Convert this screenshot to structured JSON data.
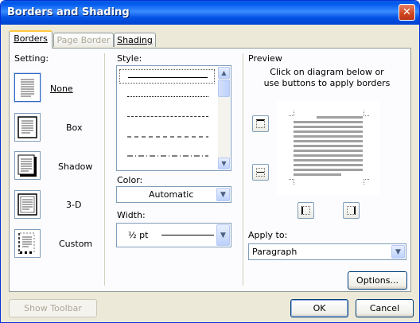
{
  "window": {
    "title": "Borders and Shading"
  },
  "tabs": [
    {
      "label": "Borders",
      "state": "active"
    },
    {
      "label": "Page Border",
      "state": "disabled"
    },
    {
      "label": "Shading",
      "state": "normal"
    }
  ],
  "setting": {
    "label": "Setting:",
    "items": [
      {
        "label": "None",
        "selected": true
      },
      {
        "label": "Box",
        "selected": false
      },
      {
        "label": "Shadow",
        "selected": false
      },
      {
        "label": "3-D",
        "selected": false
      },
      {
        "label": "Custom",
        "selected": false
      }
    ]
  },
  "style": {
    "label": "Style:",
    "items": [
      "solid",
      "dotted",
      "dashed-short",
      "dashed",
      "dash-dot"
    ]
  },
  "color": {
    "label": "Color:",
    "value": "Automatic"
  },
  "width": {
    "label": "Width:",
    "value": "½ pt"
  },
  "preview": {
    "label": "Preview",
    "hint": "Click on diagram below or use buttons to apply borders"
  },
  "apply_to": {
    "label": "Apply to:",
    "value": "Paragraph"
  },
  "buttons": {
    "options": "Options...",
    "show_toolbar": "Show Toolbar",
    "ok": "OK",
    "cancel": "Cancel"
  },
  "colors": {
    "titlebar": "#0058ee",
    "dialog_bg": "#ece9d8",
    "panel_bg": "#fcfcfe",
    "accent": "#316ac5"
  }
}
